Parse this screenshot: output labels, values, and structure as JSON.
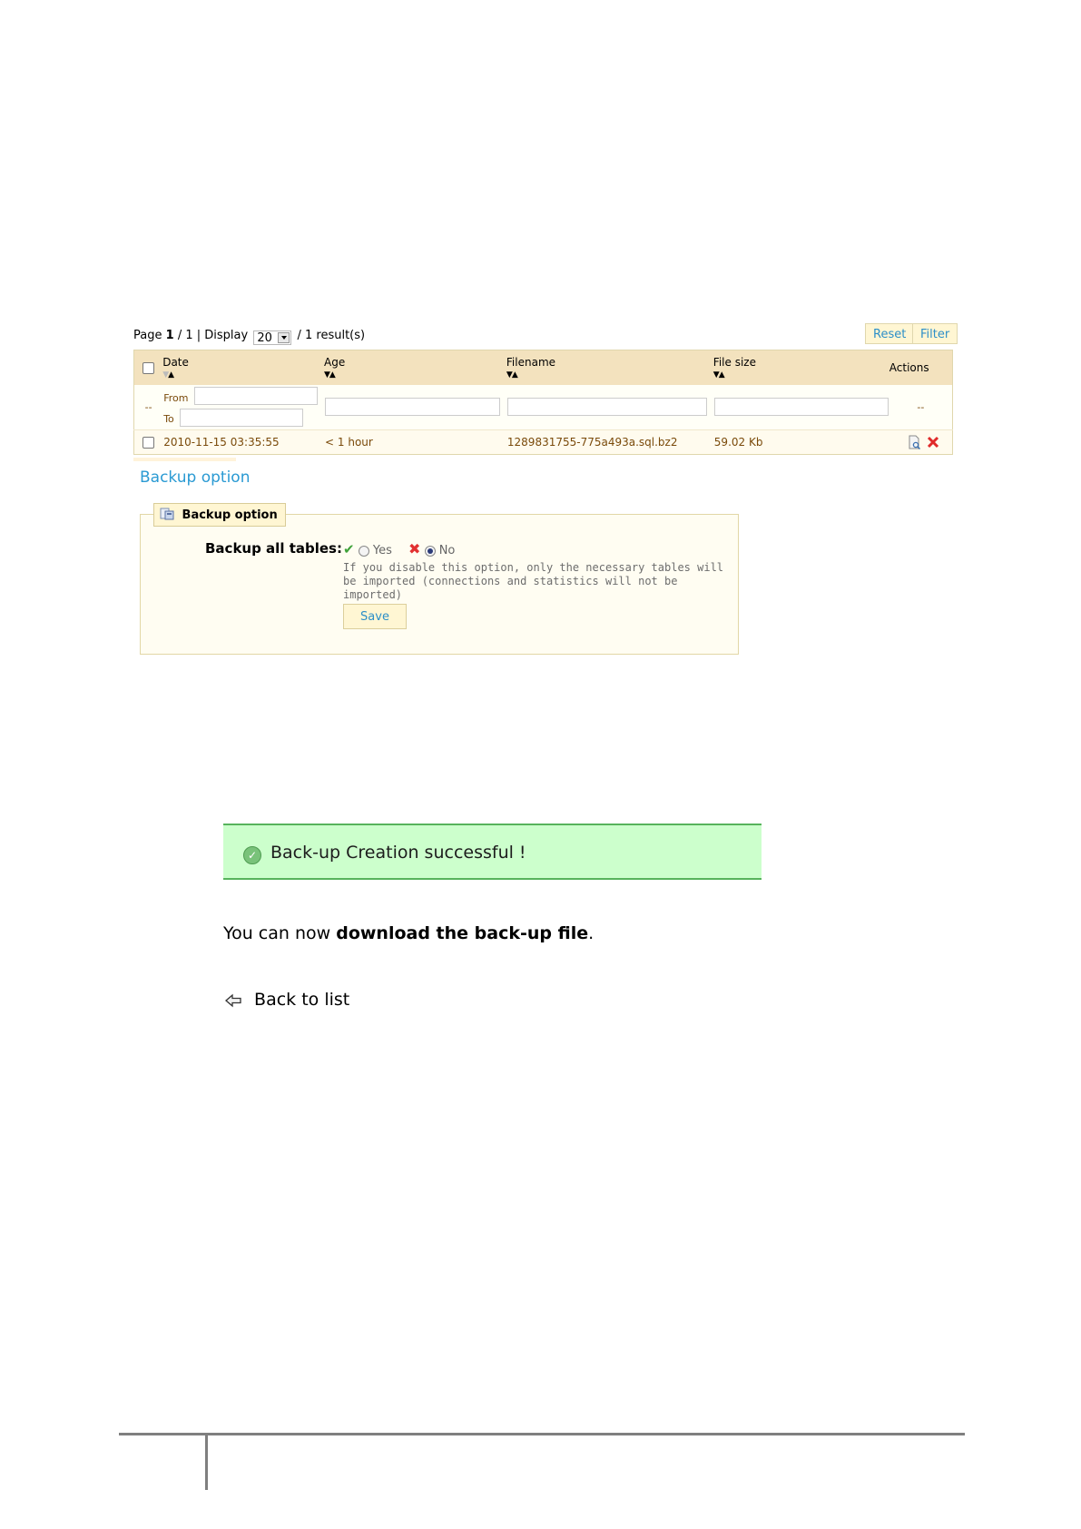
{
  "pager": {
    "page_label": "Page",
    "page_current": "1",
    "page_sep": "/",
    "page_total": "1",
    "display_label": "| Display",
    "per_page": "20",
    "results": "/ 1 result(s)"
  },
  "toolbar": {
    "reset_label": "Reset",
    "filter_label": "Filter"
  },
  "table": {
    "headers": {
      "date": "Date",
      "age": "Age",
      "filename": "Filename",
      "filesize": "File size",
      "actions": "Actions"
    },
    "filter": {
      "from_label": "From",
      "to_label": "To",
      "dash": "--"
    },
    "rows": [
      {
        "date": "2010-11-15 03:35:55",
        "age": "< 1 hour",
        "filename": "1289831755-775a493a.sql.bz2",
        "filesize": "59.02 Kb"
      }
    ]
  },
  "backup": {
    "heading": "Backup option",
    "legend": "Backup option",
    "option_label": "Backup all tables:",
    "yes_label": "Yes",
    "no_label": "No",
    "selected": "No",
    "help": "If you disable this option, only the necessary tables will be imported (connections and statistics will not be imported)",
    "save_label": "Save"
  },
  "result": {
    "success_message": "Back-up Creation successful !",
    "download_prefix": "You can now ",
    "download_link": "download the back-up file",
    "download_suffix": ".",
    "back_label": "Back to list"
  },
  "colors": {
    "accent_blue": "#2a9ad3",
    "header_bg": "#f3e2be",
    "success_bg": "#ccffcc",
    "success_border": "#57b35c"
  }
}
